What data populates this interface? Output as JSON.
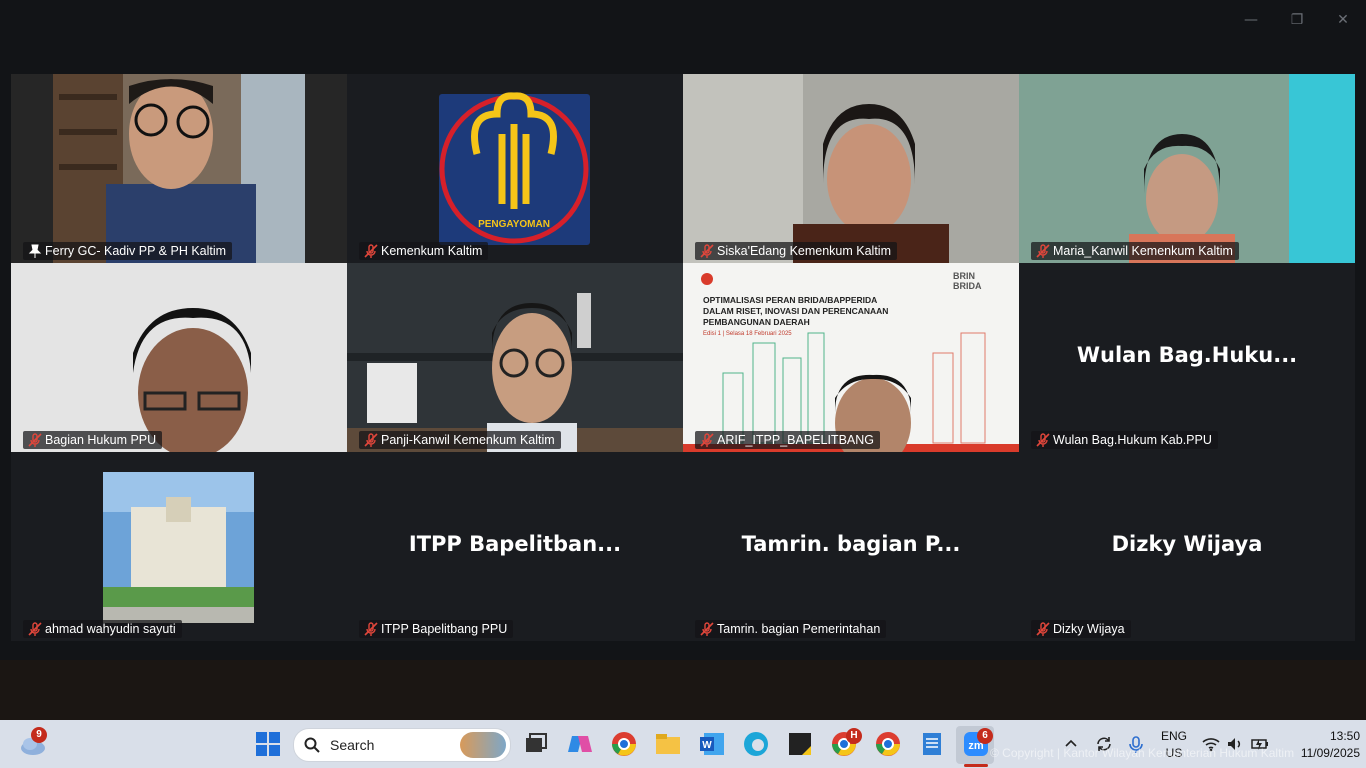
{
  "window": {
    "minimize": "—",
    "restore": "❐",
    "close": "✕"
  },
  "participants": [
    {
      "name": "Ferry GC- Kadiv PP & PH Kaltim",
      "type": "video",
      "active": true,
      "muted": false
    },
    {
      "name": "Kemenkum Kaltim",
      "type": "logo",
      "logo_text": "PENGAYOMAN",
      "muted": true
    },
    {
      "name": "Siska'Edang Kemenkum Kaltim",
      "type": "video",
      "muted": true
    },
    {
      "name": "Maria_Kanwil Kemenkum Kaltim",
      "type": "video",
      "muted": true
    },
    {
      "name": "Bagian Hukum PPU",
      "type": "video",
      "muted": true
    },
    {
      "name": "Panji-Kanwil Kemenkum Kaltim",
      "type": "video",
      "muted": true
    },
    {
      "name": "ARIF_ITPP_BAPELITBANG",
      "type": "slide",
      "muted": true,
      "slide_title": "OPTIMALISASI PERAN BRIDA/BAPPERIDA DALAM RISET, INOVASI DAN PERENCANAAN PEMBANGUNAN DAERAH",
      "slide_sub": "Edisi 1 | Selasa 18 Februari 2025",
      "slide_brand": "BRIN BRIDA"
    },
    {
      "name": "Wulan Bag.Hukum Kab.PPU",
      "type": "text",
      "display": "Wulan  Bag.Huku...",
      "muted": true
    },
    {
      "name": "ahmad wahyudin sayuti",
      "type": "photo",
      "muted": true
    },
    {
      "name": "ITPP Bapelitbang PPU",
      "type": "text",
      "display": "ITPP  Bapelitban...",
      "muted": true
    },
    {
      "name": "Tamrin. bagian Pemerintahan",
      "type": "text",
      "display": "Tamrin. bagian P...",
      "muted": true
    },
    {
      "name": "Dizky Wijaya",
      "type": "text",
      "display": "Dizky Wijaya",
      "muted": true
    }
  ],
  "taskbar": {
    "weather_badge": "9",
    "search_label": "Search",
    "chrome_badge": "H",
    "zoom_badge": "6",
    "lang": "ENG",
    "region": "US",
    "time": "13:50",
    "date": "11/09/2025",
    "watermark": "© Copyright | Kantor Wilayah Kementerian Hukum Kaltim"
  },
  "colors": {
    "active_border": "#2bd17e",
    "mute_icon": "#e0463b",
    "bg": "#121417"
  }
}
